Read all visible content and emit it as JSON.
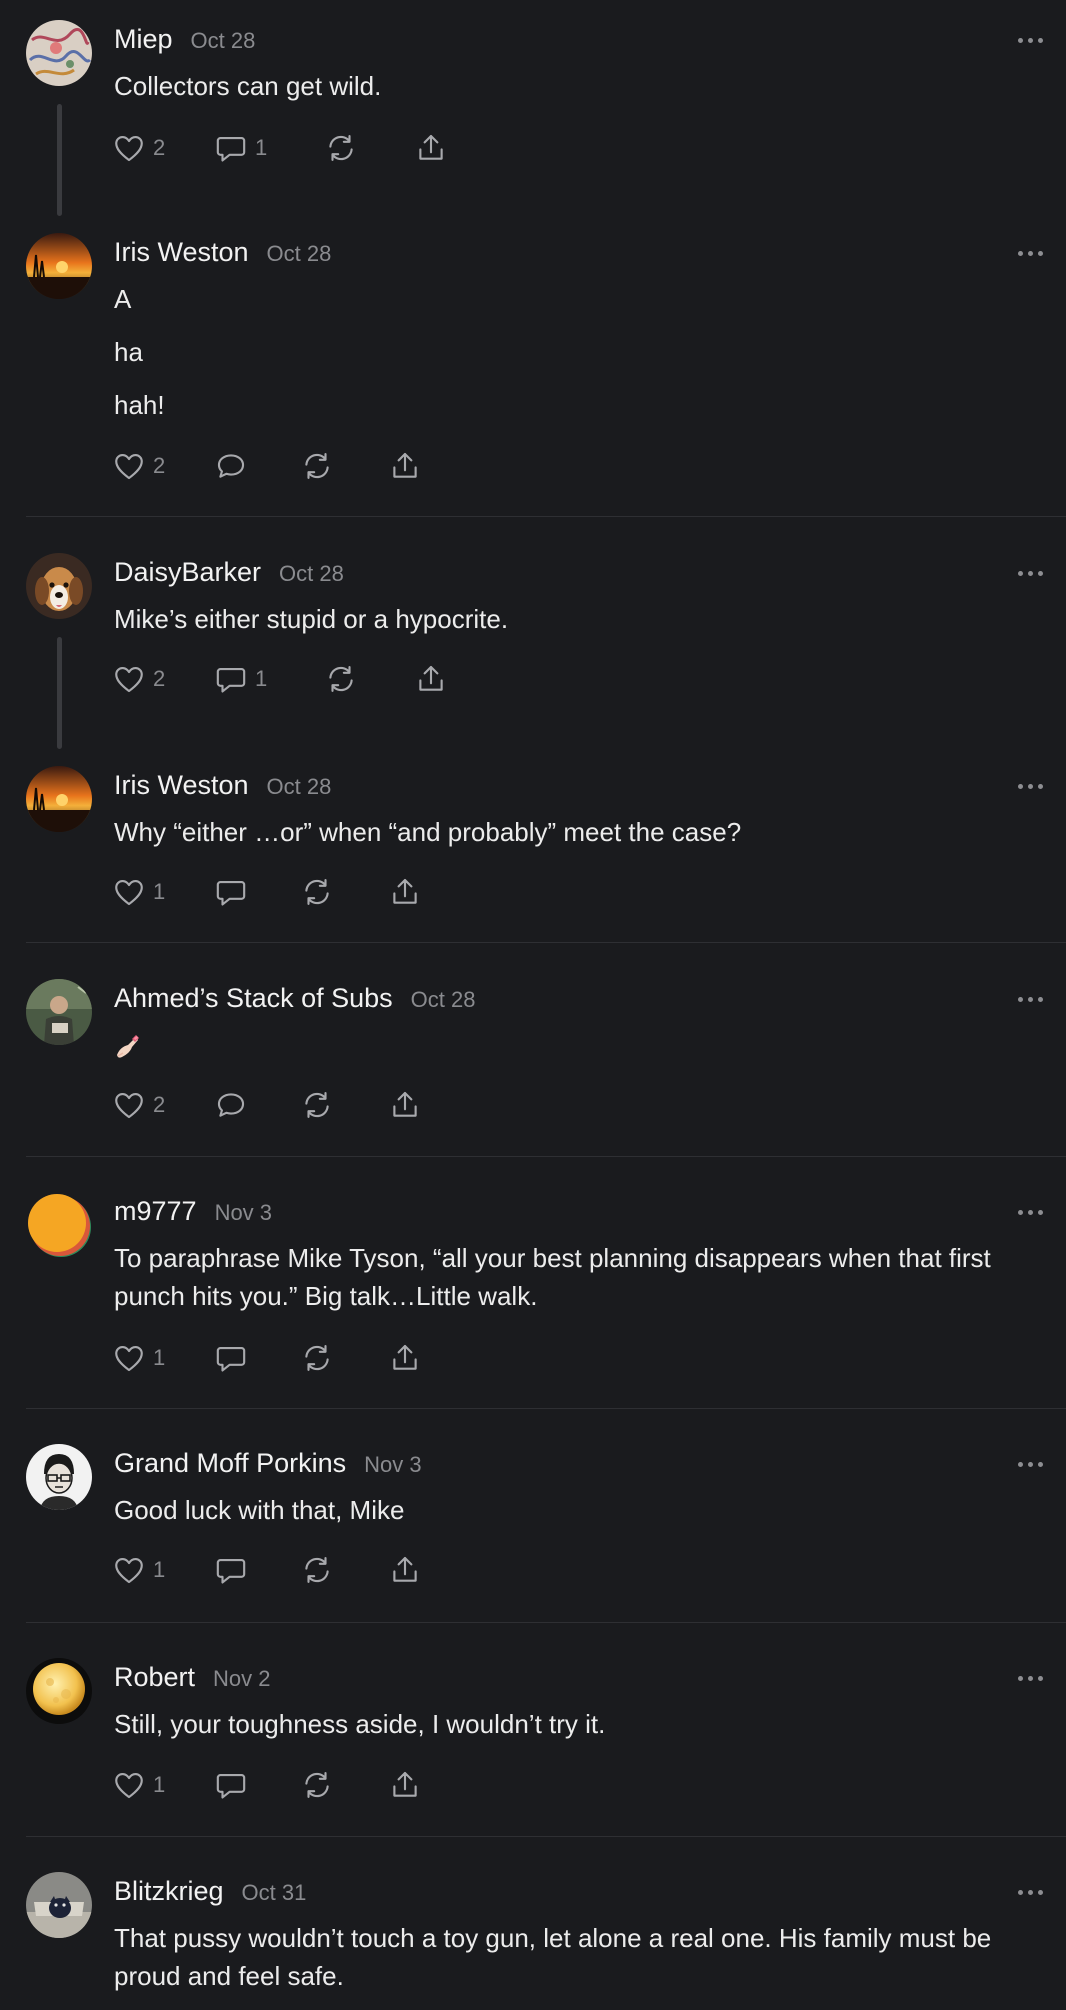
{
  "comments": [
    {
      "author": "Miep",
      "date": "Oct 28",
      "lines": [
        "Collectors can get wild."
      ],
      "likes": "2",
      "replies": "1"
    },
    {
      "author": "Iris Weston",
      "date": "Oct 28",
      "lines": [
        "A",
        "ha",
        "hah!"
      ],
      "likes": "2",
      "replies": ""
    },
    {
      "author": "DaisyBarker",
      "date": "Oct 28",
      "lines": [
        "Mike’s either stupid or a hypocrite."
      ],
      "likes": "2",
      "replies": "1"
    },
    {
      "author": "Iris Weston",
      "date": "Oct 28",
      "lines": [
        "Why “either …or” when “and probably” meet the case?"
      ],
      "likes": "1",
      "replies": ""
    },
    {
      "author": "Ahmed’s Stack of Subs",
      "date": "Oct 28",
      "lines": [
        ""
      ],
      "emoji": "nail-polish-emoji",
      "likes": "2",
      "replies": ""
    },
    {
      "author": "m9777",
      "date": "Nov 3",
      "lines": [
        "To paraphrase Mike Tyson, “all your best planning disappears when that first punch hits you.” Big talk…Little walk."
      ],
      "likes": "1",
      "replies": ""
    },
    {
      "author": "Grand Moff Porkins",
      "date": "Nov 3",
      "lines": [
        "Good luck with that, Mike"
      ],
      "likes": "1",
      "replies": ""
    },
    {
      "author": "Robert",
      "date": "Nov 2",
      "lines": [
        "Still, your toughness aside, I wouldn’t try it."
      ],
      "likes": "1",
      "replies": ""
    },
    {
      "author": "Blitzkrieg",
      "date": "Oct 31",
      "lines": [
        "That pussy wouldn’t touch a toy gun, let alone a real one. His family must be proud and feel safe."
      ],
      "likes": "",
      "replies": ""
    }
  ],
  "icons": {
    "like": "heart-icon",
    "reply": "comment-bubble-icon",
    "restack": "restack-icon",
    "share": "share-icon",
    "more": "more-dots-icon"
  },
  "colors": {
    "background": "#1a1b1e",
    "text": "#ececec",
    "muted": "#8a8b8f",
    "divider": "#2e2f33"
  }
}
